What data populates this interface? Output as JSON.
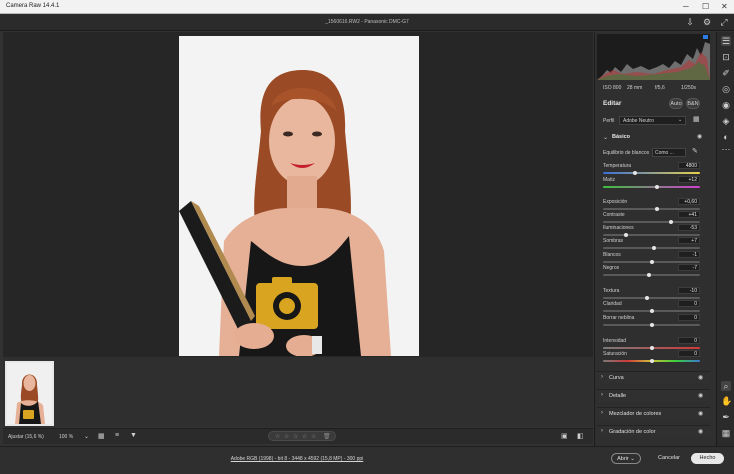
{
  "window": {
    "title": "Camera Raw 14.4.1"
  },
  "file": {
    "name": "_1560616.RW2 - Panasonic DMC-G7"
  },
  "histogram": {
    "iso": "ISO 800",
    "focal": "28 mm",
    "aperture": "f/5,6",
    "shutter": "1/250s"
  },
  "panel": {
    "title": "Editar",
    "auto_label": "Auto",
    "bw_label": "B&N",
    "profile_label": "Perfil",
    "profile_value": "Adobe Neutro",
    "basic_label": "Básico",
    "wb_label": "Equilibrio de blancos",
    "wb_value": "Como ...",
    "sliders": [
      {
        "label": "Temperatura",
        "value": "4800",
        "pos": 0.33
      },
      {
        "label": "Matiz",
        "value": "+12",
        "pos": 0.56
      },
      {
        "label": "Exposición",
        "value": "+0,60",
        "pos": 0.56
      },
      {
        "label": "Contraste",
        "value": "+41",
        "pos": 0.7
      },
      {
        "label": "Iluminaciones",
        "value": "-53",
        "pos": 0.24
      },
      {
        "label": "Sombras",
        "value": "+7",
        "pos": 0.53
      },
      {
        "label": "Blancos",
        "value": "-1",
        "pos": 0.5
      },
      {
        "label": "Negros",
        "value": "-7",
        "pos": 0.47
      },
      {
        "label": "Textura",
        "value": "-10",
        "pos": 0.45
      },
      {
        "label": "Claridad",
        "value": "0",
        "pos": 0.5
      },
      {
        "label": "Borrar neblina",
        "value": "0",
        "pos": 0.5
      },
      {
        "label": "Intensidad",
        "value": "0",
        "pos": 0.5
      },
      {
        "label": "Saturación",
        "value": "0",
        "pos": 0.5
      }
    ],
    "sections": [
      "Curva",
      "Detalle",
      "Mezclador de colores",
      "Gradación de color"
    ]
  },
  "bottom": {
    "fit_label": "Ajustar (15,6 %)",
    "zoom_label": "100 %",
    "rating": 0
  },
  "status": {
    "info": "Adobe RGB (1998) - bit 8 - 3448 x 4592 (15,8 MP) - 300 ppi",
    "open_label": "Abrir",
    "cancel_label": "Cancelar",
    "done_label": "Hecho"
  },
  "colors": {
    "accent": "#2c7be5",
    "panel_bg": "#2f2f2f"
  },
  "icons": {
    "toolbar": [
      "export-icon",
      "settings-icon",
      "fullscreen-icon"
    ],
    "right_tools": [
      "edit-icon",
      "crop-icon",
      "heal-icon",
      "mask-icon",
      "redeye-icon",
      "presets-icon",
      "more-icon"
    ],
    "right_bottom": [
      "zoom-icon",
      "hand-icon",
      "eyedropper-icon",
      "grid-icon"
    ]
  }
}
